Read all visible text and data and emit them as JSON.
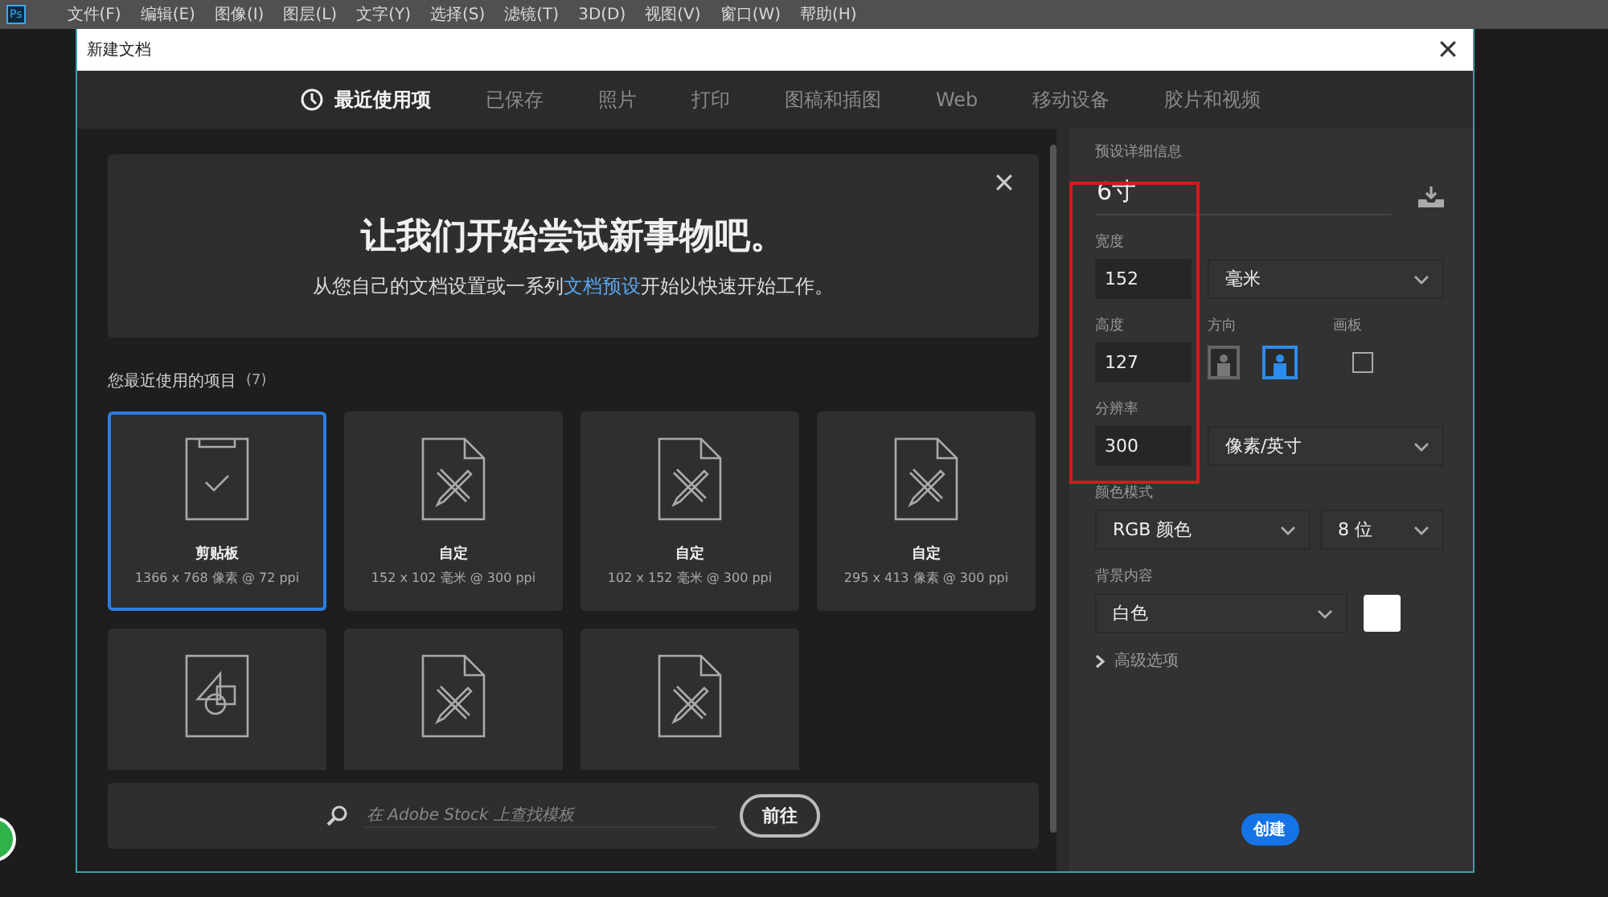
{
  "app_icon": "Ps",
  "menu": [
    "文件(F)",
    "编辑(E)",
    "图像(I)",
    "图层(L)",
    "文字(Y)",
    "选择(S)",
    "滤镜(T)",
    "3D(D)",
    "视图(V)",
    "窗口(W)",
    "帮助(H)"
  ],
  "dialog": {
    "title": "新建文档",
    "tabs": [
      {
        "label": "最近使用项",
        "selected": true,
        "kind": "recent"
      },
      {
        "label": "已保存",
        "selected": false,
        "kind": "plain"
      },
      {
        "label": "照片",
        "selected": false,
        "kind": "plain"
      },
      {
        "label": "打印",
        "selected": false,
        "kind": "plain"
      },
      {
        "label": "图稿和插图",
        "selected": false,
        "kind": "plain"
      },
      {
        "label": "Web",
        "selected": false,
        "kind": "plain"
      },
      {
        "label": "移动设备",
        "selected": false,
        "kind": "plain"
      },
      {
        "label": "胶片和视频",
        "selected": false,
        "kind": "plain"
      }
    ],
    "hero": {
      "title": "让我们开始尝试新事物吧。",
      "text_before": "从您自己的文档设置或一系列",
      "link": "文档预设",
      "text_after": "开始以快速开始工作。"
    },
    "recent": {
      "heading": "您最近使用的项目",
      "count": "(7)",
      "items": [
        {
          "kind": "clipboard",
          "name": "剪贴板",
          "detail": "1366 x 768 像素 @ 72 ppi",
          "selected": true
        },
        {
          "kind": "custom",
          "name": "自定",
          "detail": "152 x 102 毫米 @ 300 ppi",
          "selected": false
        },
        {
          "kind": "custom",
          "name": "自定",
          "detail": "102 x 152 毫米 @ 300 ppi",
          "selected": false
        },
        {
          "kind": "custom",
          "name": "自定",
          "detail": "295 x 413 像素 @ 300 ppi",
          "selected": false
        },
        {
          "kind": "shapes",
          "selected": false
        },
        {
          "kind": "custom",
          "selected": false
        },
        {
          "kind": "custom",
          "selected": false
        }
      ]
    },
    "search": {
      "placeholder": "在 Adobe Stock 上查找模板",
      "button": "前往"
    },
    "details": {
      "heading": "预设详细信息",
      "preset_name": "6寸",
      "width": {
        "label": "宽度",
        "value": "152",
        "unit": "毫米"
      },
      "height": {
        "label": "高度",
        "value": "127"
      },
      "orientation": {
        "label": "方向",
        "options": [
          {
            "kind": "portrait",
            "selected": false
          },
          {
            "kind": "landscape",
            "selected": true
          }
        ]
      },
      "artboard": {
        "label": "画板",
        "checked": false
      },
      "resolution": {
        "label": "分辨率",
        "value": "300",
        "unit": "像素/英寸"
      },
      "color_mode": {
        "label": "颜色模式",
        "mode": "RGB 颜色",
        "depth": "8 位"
      },
      "background": {
        "label": "背景内容",
        "value": "白色",
        "color": "#ffffff"
      },
      "advanced": {
        "label": "高级选项",
        "expanded": false
      },
      "create": "创建"
    }
  }
}
